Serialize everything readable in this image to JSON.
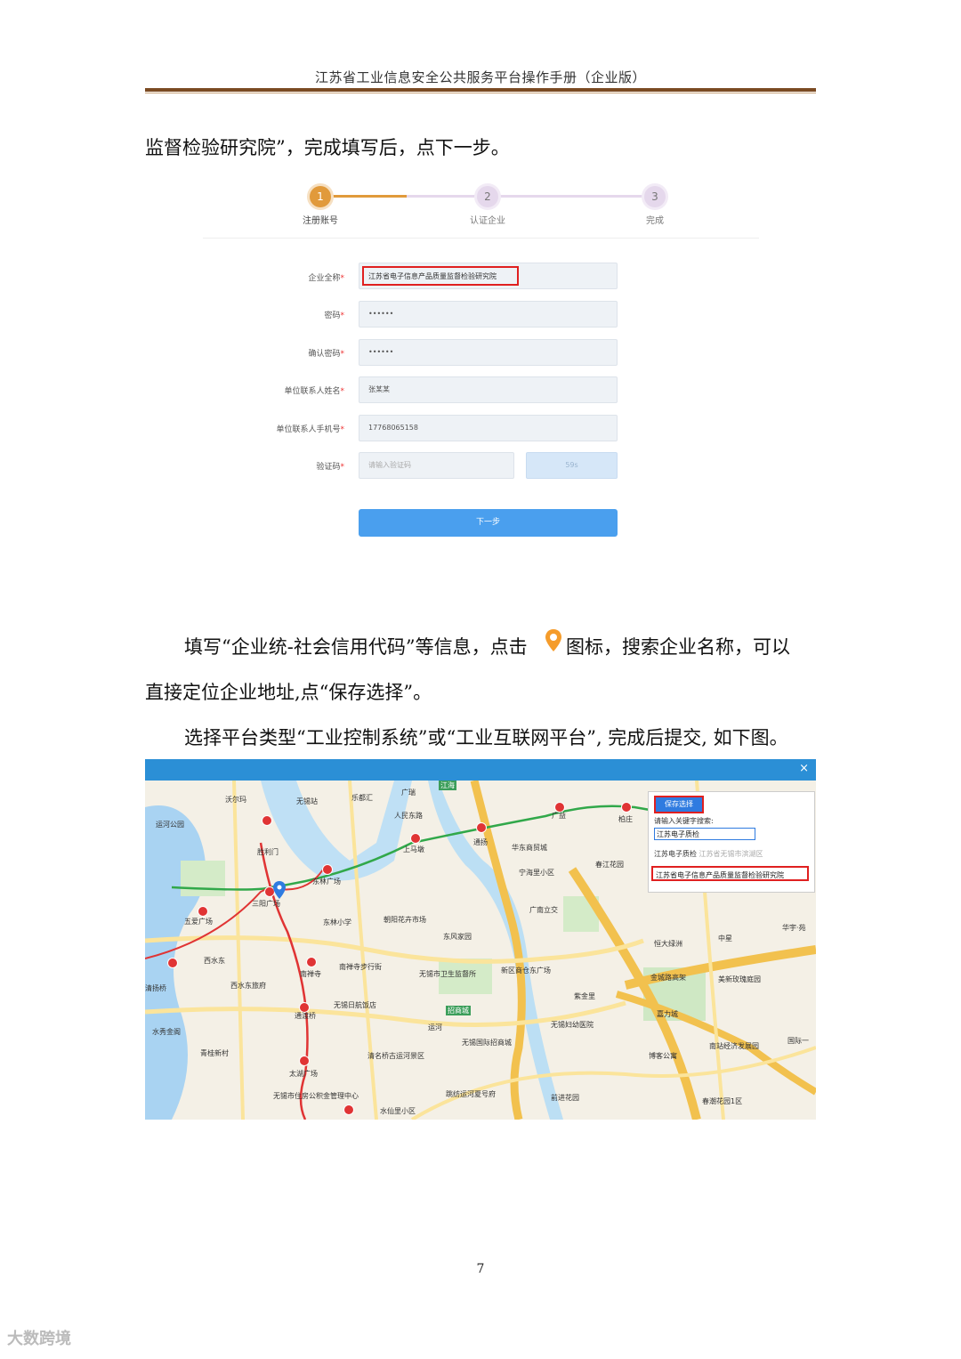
{
  "header": {
    "title": "江苏省工业信息安全公共服务平台操作手册（企业版）"
  },
  "paragraphs": {
    "p1": "监督检验研究院”，完成填写后，点下一步。",
    "p2a": "填写“企业统-社会信用代码”等信息，点击",
    "p2b": "图标，搜索企业名称，可以",
    "p3": "直接定位企业地址,点“保存选择”。",
    "p4": "选择平台类型“工业控制系统”或“工业互联网平台”, 完成后提交, 如下图。"
  },
  "steps": [
    {
      "num": "1",
      "label": "注册账号"
    },
    {
      "num": "2",
      "label": "认证企业"
    },
    {
      "num": "3",
      "label": "完成"
    }
  ],
  "form": {
    "fields": [
      {
        "label": "企业全称",
        "value": "江苏省电子信息产品质量监督检验研究院"
      },
      {
        "label": "密码",
        "value": "••••••"
      },
      {
        "label": "确认密码",
        "value": "••••••"
      },
      {
        "label": "单位联系人姓名",
        "value": "张某某"
      },
      {
        "label": "单位联系人手机号",
        "value": "17768065158"
      },
      {
        "label": "验证码",
        "placeholder": "请输入验证码"
      }
    ],
    "req": "*",
    "countdown": "59s",
    "next_button": "下一步"
  },
  "map": {
    "close": "×",
    "save_button": "保存选择",
    "search_prompt": "请输入关键字搜索:",
    "search_value": "江苏电子质检",
    "result1_name": "江苏电子质检",
    "result1_addr": "江苏省无锡市滨湖区",
    "result2": "江苏省电子信息产品质量监督检验研究院",
    "labels": [
      "沃尔玛",
      "无锡站",
      "乐都汇",
      "广瑞",
      "江海",
      "运河公园",
      "胜利门",
      "人民东路",
      "上马墩",
      "通扬",
      "华东商贸城",
      "广益",
      "柏庄",
      "三阳广场",
      "东林广场",
      "春江花园",
      "宁海里小区",
      "东林小学",
      "朝阳花卉市场",
      "广南立交",
      "五爱广场",
      "东风家园",
      "恒大绿洲",
      "中星",
      "华宇·苑",
      "南禅寺",
      "南禅寺步行街",
      "无锡市卫生监督所",
      "新区商仓东广场",
      "金城路高架",
      "美新玫瑰庭园",
      "西水东",
      "西水东旅府",
      "无锡日航饭店",
      "紫金里",
      "清扬桥",
      "招商城",
      "无锡妇幼医院",
      "嘉力城",
      "水秀金阁",
      "青桂新村",
      "无锡国际招商城",
      "清名桥古运河景区",
      "南站经济发展园",
      "国际一",
      "太湖广场",
      "博客公寓",
      "无锡市住房公积金管理中心",
      "跳纺运河夏号府",
      "前进花园",
      "春潮花园1区",
      "水仙里小区",
      "通渡桥",
      "运河"
    ],
    "colors": {
      "bar": "#2b8fd6",
      "highlight": "#e02020"
    }
  },
  "page_number": "7",
  "watermark": "大数跨境"
}
